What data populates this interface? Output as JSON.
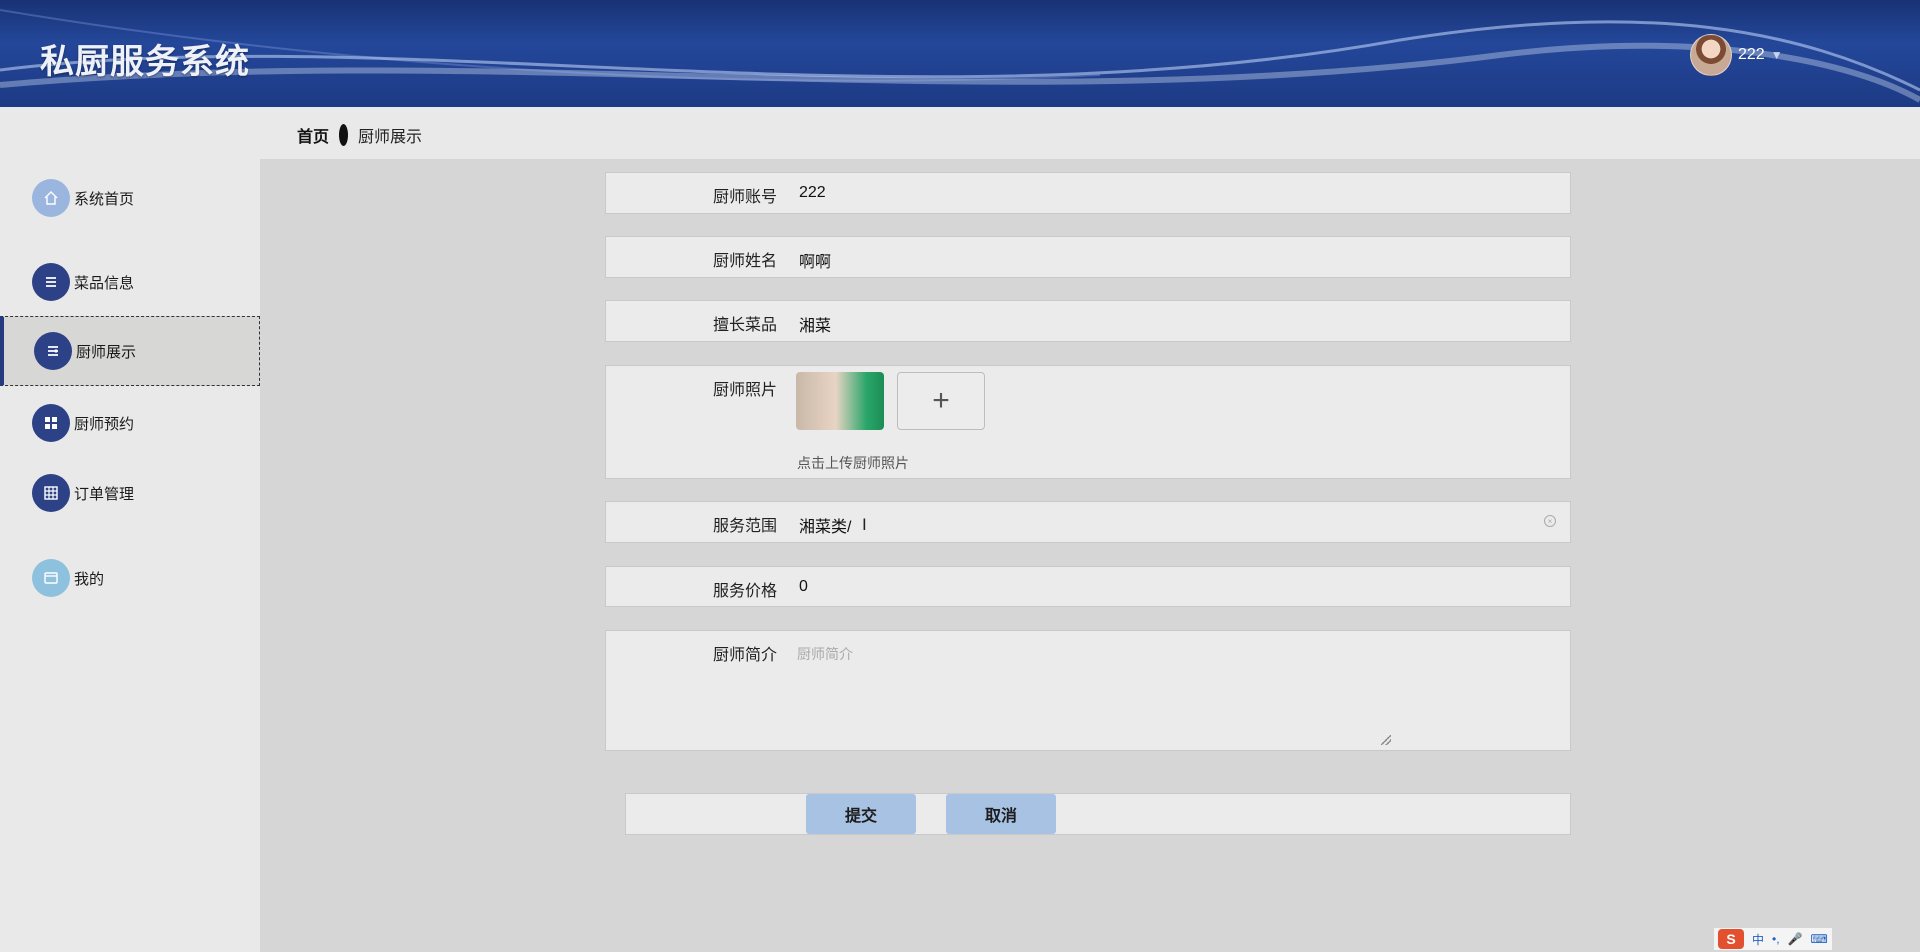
{
  "header": {
    "title": "私厨服务系统",
    "username": "222",
    "caret": "▼"
  },
  "breadcrumb": {
    "home": "首页",
    "current": "厨师展示"
  },
  "sidebar": {
    "items": [
      {
        "label": "系统首页",
        "icon": "home-icon"
      },
      {
        "label": "菜品信息",
        "icon": "list-icon"
      },
      {
        "label": "厨师展示",
        "icon": "list-icon",
        "active": true
      },
      {
        "label": "厨师预约",
        "icon": "grid-icon"
      },
      {
        "label": "订单管理",
        "icon": "table-icon"
      },
      {
        "label": "我的",
        "icon": "card-icon"
      }
    ]
  },
  "form": {
    "account": {
      "label": "厨师账号",
      "value": "222"
    },
    "name": {
      "label": "厨师姓名",
      "value": "啊啊"
    },
    "specialty": {
      "label": "擅长菜品",
      "value": "湘菜"
    },
    "photo": {
      "label": "厨师照片",
      "upload_plus": "+",
      "hint": "点击上传厨师照片"
    },
    "service_scope": {
      "label": "服务范围",
      "value": "湘菜类/",
      "cursor": "I"
    },
    "price": {
      "label": "服务价格",
      "value": "0"
    },
    "intro": {
      "label": "厨师简介",
      "placeholder": "厨师简介"
    }
  },
  "buttons": {
    "submit": "提交",
    "cancel": "取消"
  },
  "ime": {
    "logo": "S",
    "lang": "中",
    "punct": "•,",
    "mic": "🎤",
    "keyboard": "⌨"
  },
  "colors": {
    "header": "#1f3c88",
    "nav_icon": "#2c4186",
    "button": "#a8c2e4"
  }
}
